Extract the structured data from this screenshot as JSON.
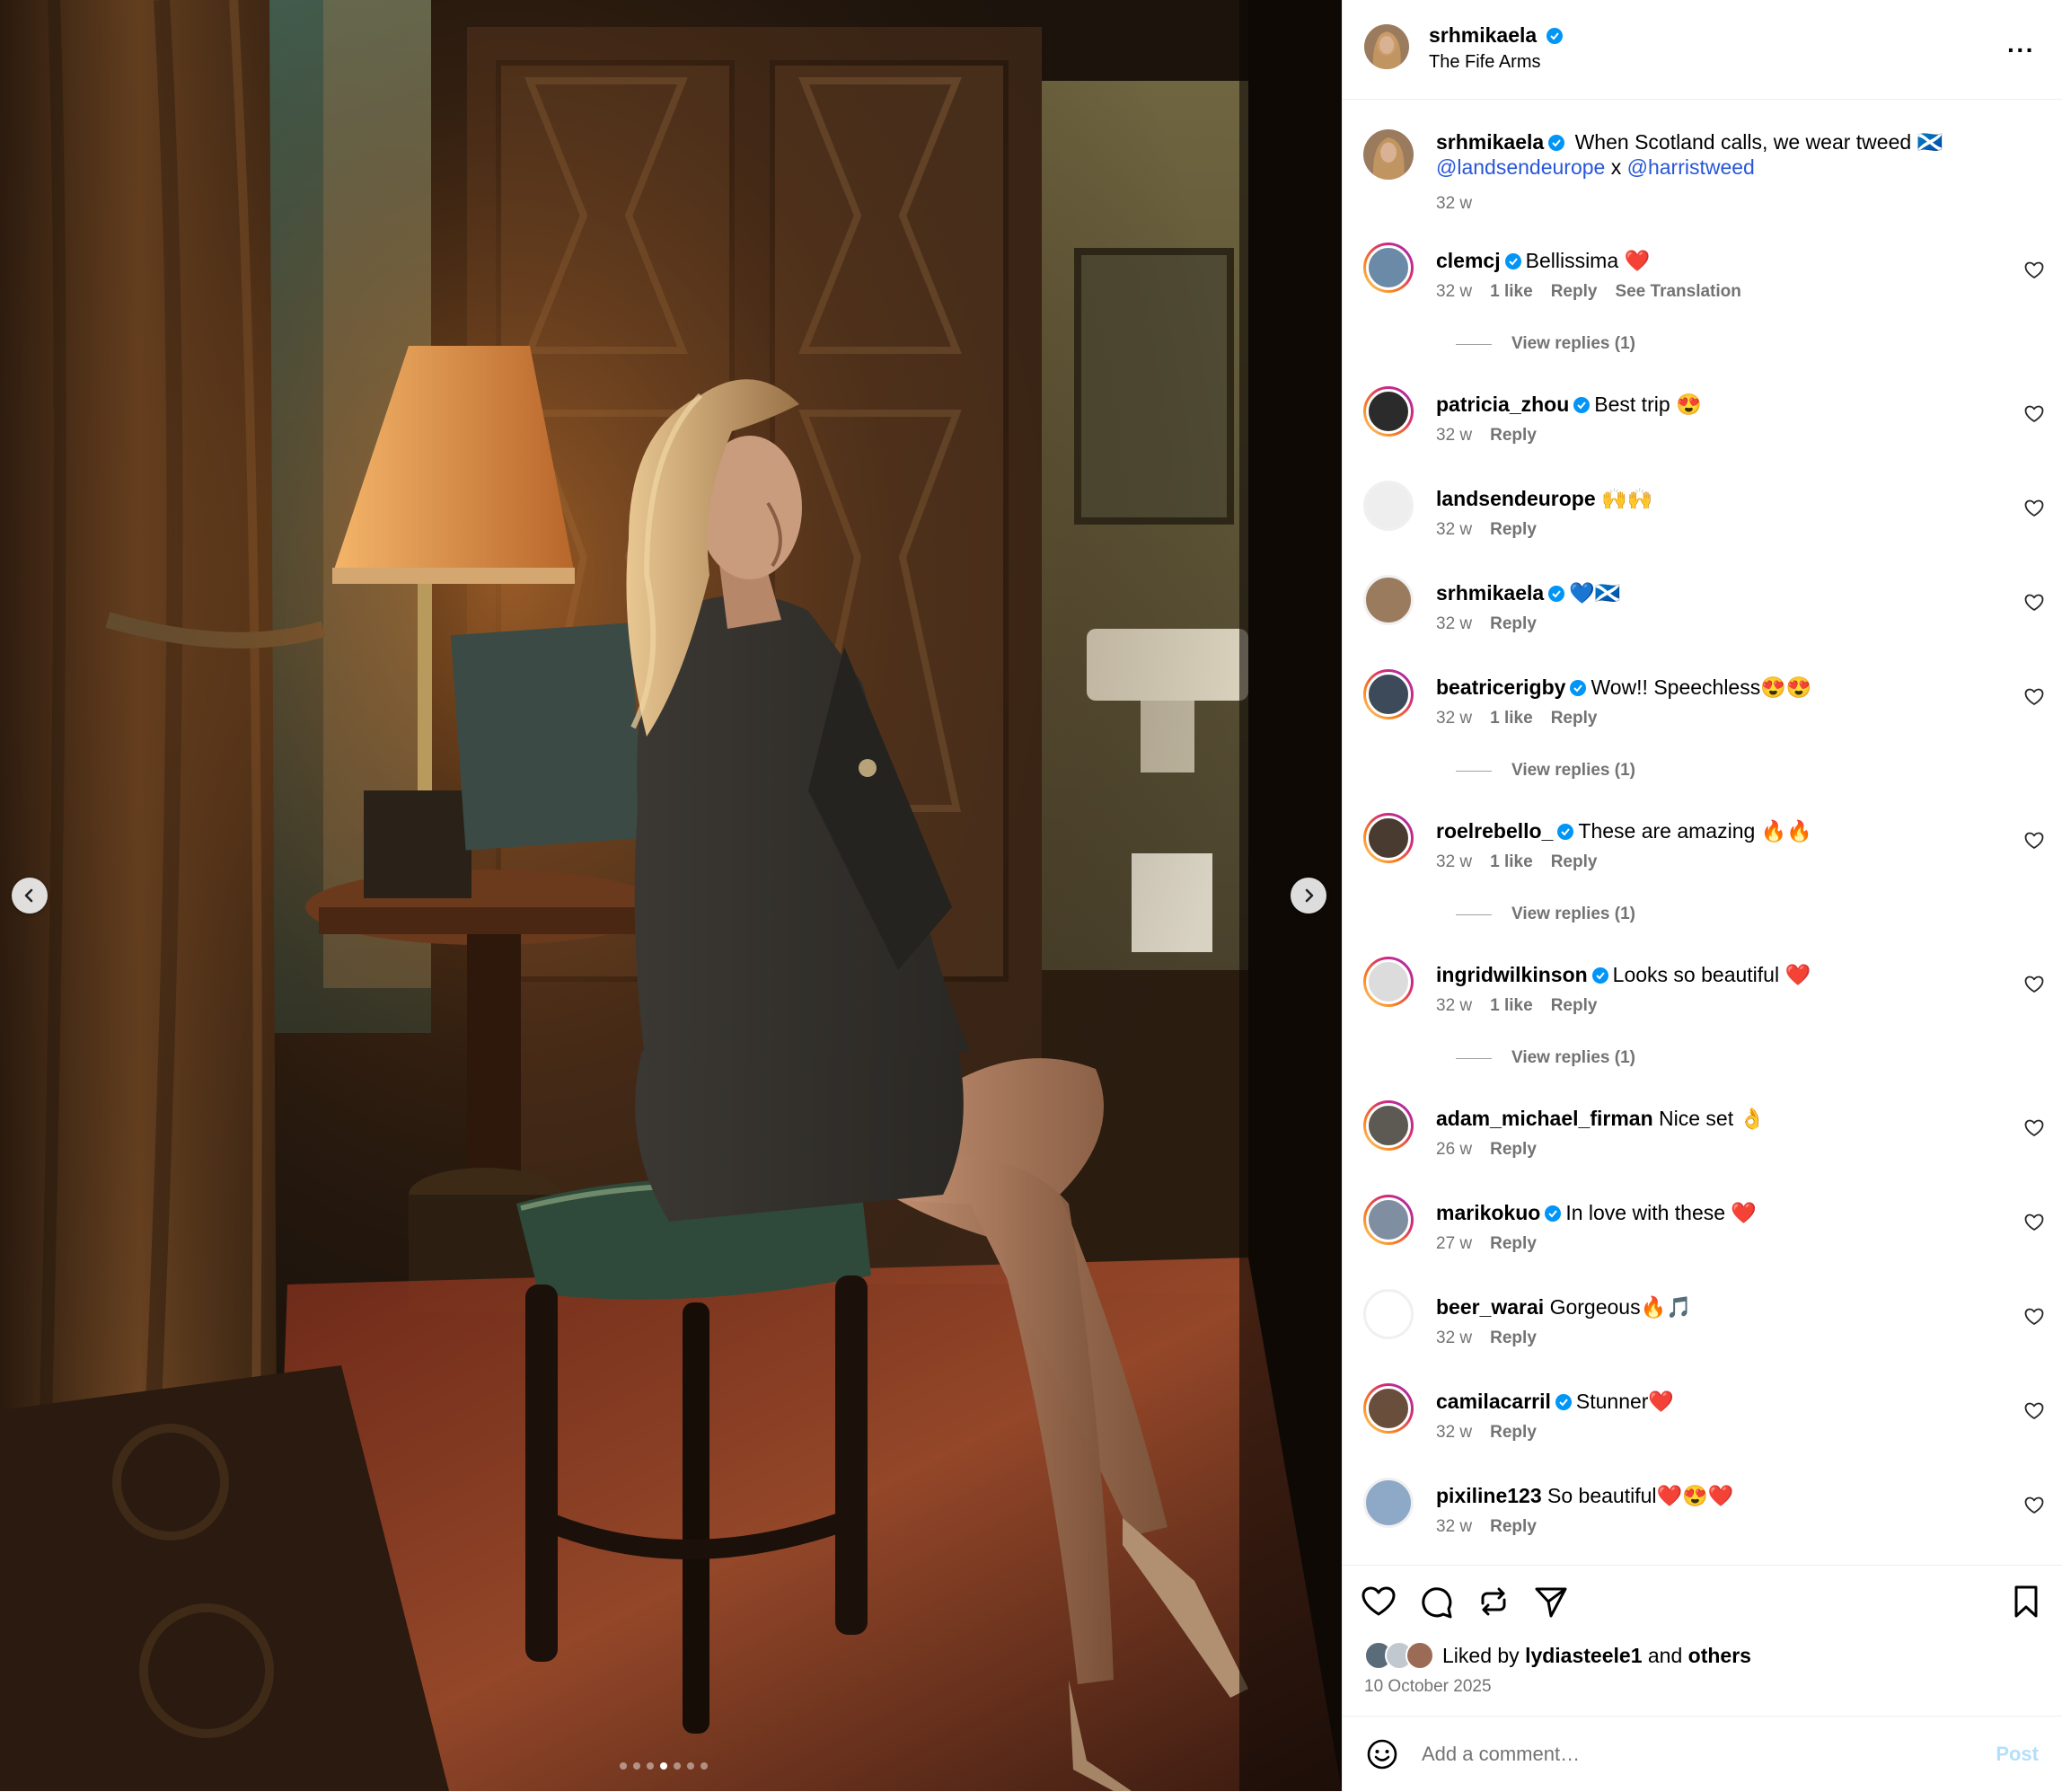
{
  "post": {
    "username": "srhmikaela",
    "location": "The Fife Arms",
    "more_icon": "···",
    "caption_user": "srhmikaela",
    "caption_text": "When Scotland calls, we wear tweed 🏴󠁧󠁢󠁳󠁣󠁴󠁿",
    "caption_mention1": "@landsendeurope",
    "caption_x": " x ",
    "caption_mention2": "@harristweed",
    "caption_age": "32 w",
    "image_alt": "Woman in grey tweed suit sitting on an upholstered stool in a lamp-lit room"
  },
  "carousel": {
    "count": 7,
    "active_index": 3
  },
  "comments": [
    {
      "user": "clemcj",
      "verified": true,
      "text": "Bellissima ❤️",
      "age": "32 w",
      "likes": "1 like",
      "reply": "Reply",
      "translate": "See Translation",
      "view_replies": "View replies (1)"
    },
    {
      "user": "patricia_zhou",
      "verified": true,
      "text": "Best trip 😍",
      "age": "32 w",
      "reply": "Reply"
    },
    {
      "user": "landsendeurope",
      "verified": false,
      "text": "🙌🙌",
      "age": "32 w",
      "reply": "Reply"
    },
    {
      "user": "srhmikaela",
      "verified": true,
      "text": "💙🏴󠁧󠁢󠁳󠁣󠁴󠁿",
      "age": "32 w",
      "reply": "Reply"
    },
    {
      "user": "beatricerigby",
      "verified": true,
      "text": "Wow!! Speechless😍😍",
      "age": "32 w",
      "likes": "1 like",
      "reply": "Reply",
      "view_replies": "View replies (1)"
    },
    {
      "user": "roelrebello_",
      "verified": true,
      "text": "These are amazing 🔥🔥",
      "age": "32 w",
      "likes": "1 like",
      "reply": "Reply",
      "view_replies": "View replies (1)"
    },
    {
      "user": "ingridwilkinson",
      "verified": true,
      "text": "Looks so beautiful ❤️",
      "age": "32 w",
      "likes": "1 like",
      "reply": "Reply",
      "view_replies": "View replies (1)"
    },
    {
      "user": "adam_michael_firman",
      "verified": false,
      "text": "Nice set 👌",
      "age": "26 w",
      "reply": "Reply"
    },
    {
      "user": "marikokuo",
      "verified": true,
      "text": "In love with these ❤️",
      "age": "27 w",
      "reply": "Reply"
    },
    {
      "user": "beer_warai",
      "verified": false,
      "text": "Gorgeous🔥🎵",
      "age": "32 w",
      "reply": "Reply"
    },
    {
      "user": "camilacarril",
      "verified": true,
      "text": "Stunner❤️",
      "age": "32 w",
      "reply": "Reply"
    },
    {
      "user": "pixiline123",
      "verified": false,
      "text": "So beautiful❤️😍❤️",
      "age": "32 w",
      "reply": "Reply"
    }
  ],
  "footer": {
    "liked_by_prefix": "Liked by ",
    "liked_by_user": "lydiasteele1",
    "liked_by_mid": " and ",
    "liked_by_others": "others",
    "date": "10 October 2025",
    "comment_placeholder": "Add a comment…",
    "post_label": "Post"
  },
  "colors": {
    "accent_blue": "#0095f6",
    "verified_blue": "#0095f6",
    "muted": "#737373",
    "post_disabled": "#b2dffc"
  }
}
